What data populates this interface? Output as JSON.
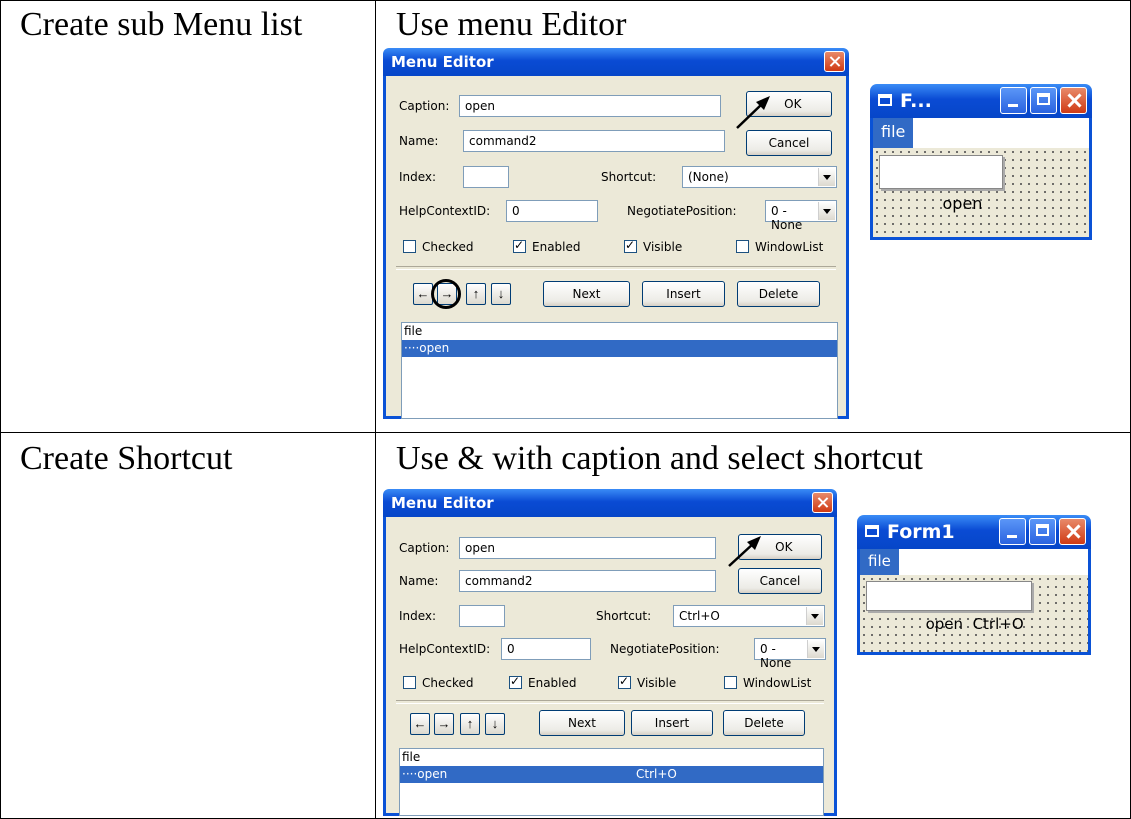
{
  "rows": [
    {
      "label": "Create sub Menu list",
      "title": "Use menu Editor"
    },
    {
      "label": "Create Shortcut",
      "title": "Use & with caption and select shortcut"
    }
  ],
  "editor1": {
    "title": "Menu Editor",
    "caption_label": "Caption:",
    "caption_value": "open",
    "name_label": "Name:",
    "name_value": "command2",
    "index_label": "Index:",
    "index_value": "",
    "shortcut_label": "Shortcut:",
    "shortcut_value": "(None)",
    "help_label": "HelpContextID:",
    "help_value": "0",
    "negotiate_label": "NegotiatePosition:",
    "negotiate_value": "0 - None",
    "checked": "Checked",
    "enabled": "Enabled",
    "visible": "Visible",
    "windowlist": "WindowList",
    "ok": "OK",
    "cancel": "Cancel",
    "next": "Next",
    "insert": "Insert",
    "delete": "Delete",
    "list": [
      "file",
      "····open"
    ]
  },
  "editor2": {
    "title": "Menu Editor",
    "caption_label": "Caption:",
    "caption_value": "open",
    "name_label": "Name:",
    "name_value": "command2",
    "index_label": "Index:",
    "index_value": "",
    "shortcut_label": "Shortcut:",
    "shortcut_value": "Ctrl+O",
    "help_label": "HelpContextID:",
    "help_value": "0",
    "negotiate_label": "NegotiatePosition:",
    "negotiate_value": "0 - None",
    "checked": "Checked",
    "enabled": "Enabled",
    "visible": "Visible",
    "windowlist": "WindowList",
    "ok": "OK",
    "cancel": "Cancel",
    "next": "Next",
    "insert": "Insert",
    "delete": "Delete",
    "list": [
      "file",
      "····open"
    ],
    "list_shortcut": "Ctrl+O"
  },
  "form1": {
    "title": "F...",
    "menu": "file",
    "item": "open"
  },
  "form2": {
    "title": "Form1",
    "menu": "file",
    "item": "open  Ctrl+O"
  },
  "arrows": {
    "left": "←",
    "right": "→",
    "up": "↑",
    "down": "↓"
  }
}
